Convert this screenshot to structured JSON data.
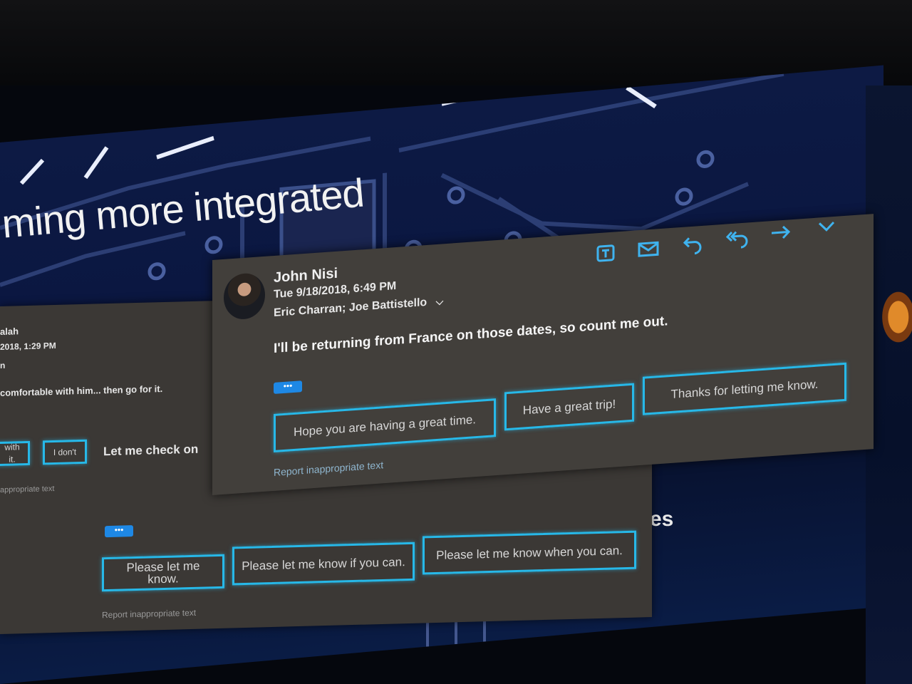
{
  "slide": {
    "headline": "ming more integrated",
    "partial_word": "es"
  },
  "email_front": {
    "sender": "John Nisi",
    "date": "Tue 9/18/2018, 6:49 PM",
    "recipients": "Eric Charran; Joe Battistello",
    "body": "I'll be returning from France on those dates, so count me out.",
    "more_pill": "•••",
    "suggested_replies": [
      "Hope you are having a great time.",
      "Have a great trip!",
      "Thanks for letting me know."
    ],
    "report_link": "Report inappropriate text",
    "toolbar_icons": [
      "teams-icon",
      "mail-icon",
      "reply-icon",
      "reply-all-icon",
      "forward-icon",
      "chevron-down-icon"
    ]
  },
  "email_back": {
    "sender_fragment": "alah",
    "date_fragment": "2018, 1:29 PM",
    "recipient_fragment": "n",
    "body_fragment": "comfortable with him... then go for it.",
    "top_replies": [
      "with it.",
      "I don't"
    ],
    "inline_text": "Let me check on",
    "report_link_top": "appropriate text",
    "more_pill": "•••",
    "suggested_replies": [
      "Please let me know.",
      "Please let me know if you can.",
      "Please let me know when you can."
    ],
    "report_link": "Report inappropriate text"
  },
  "colors": {
    "accent": "#27b8e8",
    "card_front": "#423f3b",
    "card_back": "#3b3835",
    "pill": "#1e88e5"
  }
}
